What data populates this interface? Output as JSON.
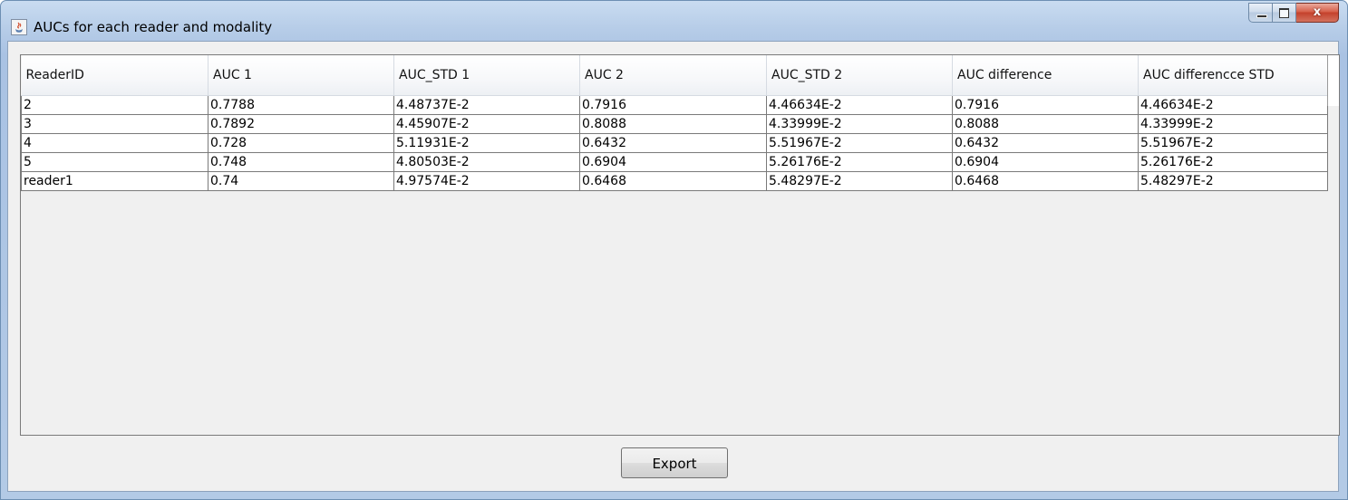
{
  "window": {
    "title": "AUCs for each reader and modality",
    "app_icon": "java-cup-icon",
    "buttons": {
      "minimize_icon": "minimize-icon",
      "maximize_icon": "maximize-icon",
      "close_icon": "close-icon",
      "close_glyph": "x"
    }
  },
  "table": {
    "headers": [
      "ReaderID",
      "AUC 1",
      "AUC_STD 1",
      "AUC 2",
      "AUC_STD 2",
      "AUC difference",
      "AUC differencce STD"
    ],
    "rows": [
      [
        "2",
        "0.7788",
        "4.48737E-2",
        "0.7916",
        "4.46634E-2",
        "0.7916",
        "4.46634E-2"
      ],
      [
        "3",
        "0.7892",
        "4.45907E-2",
        "0.8088",
        "4.33999E-2",
        "0.8088",
        "4.33999E-2"
      ],
      [
        "4",
        "0.728",
        "5.11931E-2",
        "0.6432",
        "5.51967E-2",
        "0.6432",
        "5.51967E-2"
      ],
      [
        "5",
        "0.748",
        "4.80503E-2",
        "0.6904",
        "5.26176E-2",
        "0.6904",
        "5.26176E-2"
      ],
      [
        "reader1",
        "0.74",
        "4.97574E-2",
        "0.6468",
        "5.48297E-2",
        "0.6468",
        "5.48297E-2"
      ]
    ]
  },
  "footer": {
    "export_label": "Export"
  },
  "colors": {
    "titlebar": "#b7cde8",
    "close_button": "#c4412b",
    "client_background": "#f0f0f0",
    "cell_background": "#ffffff",
    "grid_lines": "#7a7a7a"
  }
}
